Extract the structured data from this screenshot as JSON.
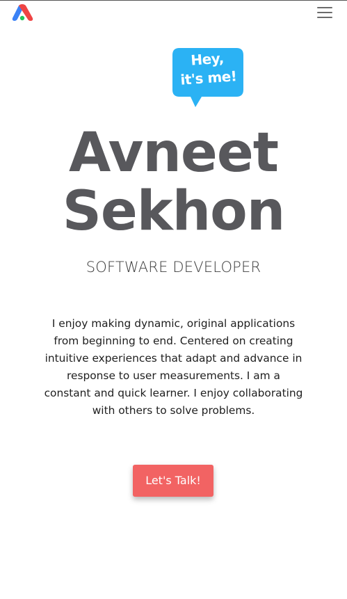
{
  "header": {
    "logo_icon": "triangle-logo",
    "menu_icon": "hamburger-menu-icon"
  },
  "hero": {
    "bubble": {
      "line1": "Hey,",
      "line2": "it's me!",
      "color": "#2bb2f4"
    },
    "name_first": "Avneet",
    "name_last": "Sekhon",
    "role": "SOFTWARE DEVELOPER",
    "bio_lines": [
      "I enjoy making dynamic, original applications",
      "from beginning to end. Centered on creating",
      "intuitive experiences that adapt and advance in",
      "response to user measurements. I am a",
      "constant and quick learner. I enjoy collaborating",
      "with others to solve problems."
    ],
    "cta_label": "Let's Talk!"
  },
  "colors": {
    "accent": "#f26363",
    "heading": "#58585c",
    "bubble": "#2bb2f4"
  }
}
